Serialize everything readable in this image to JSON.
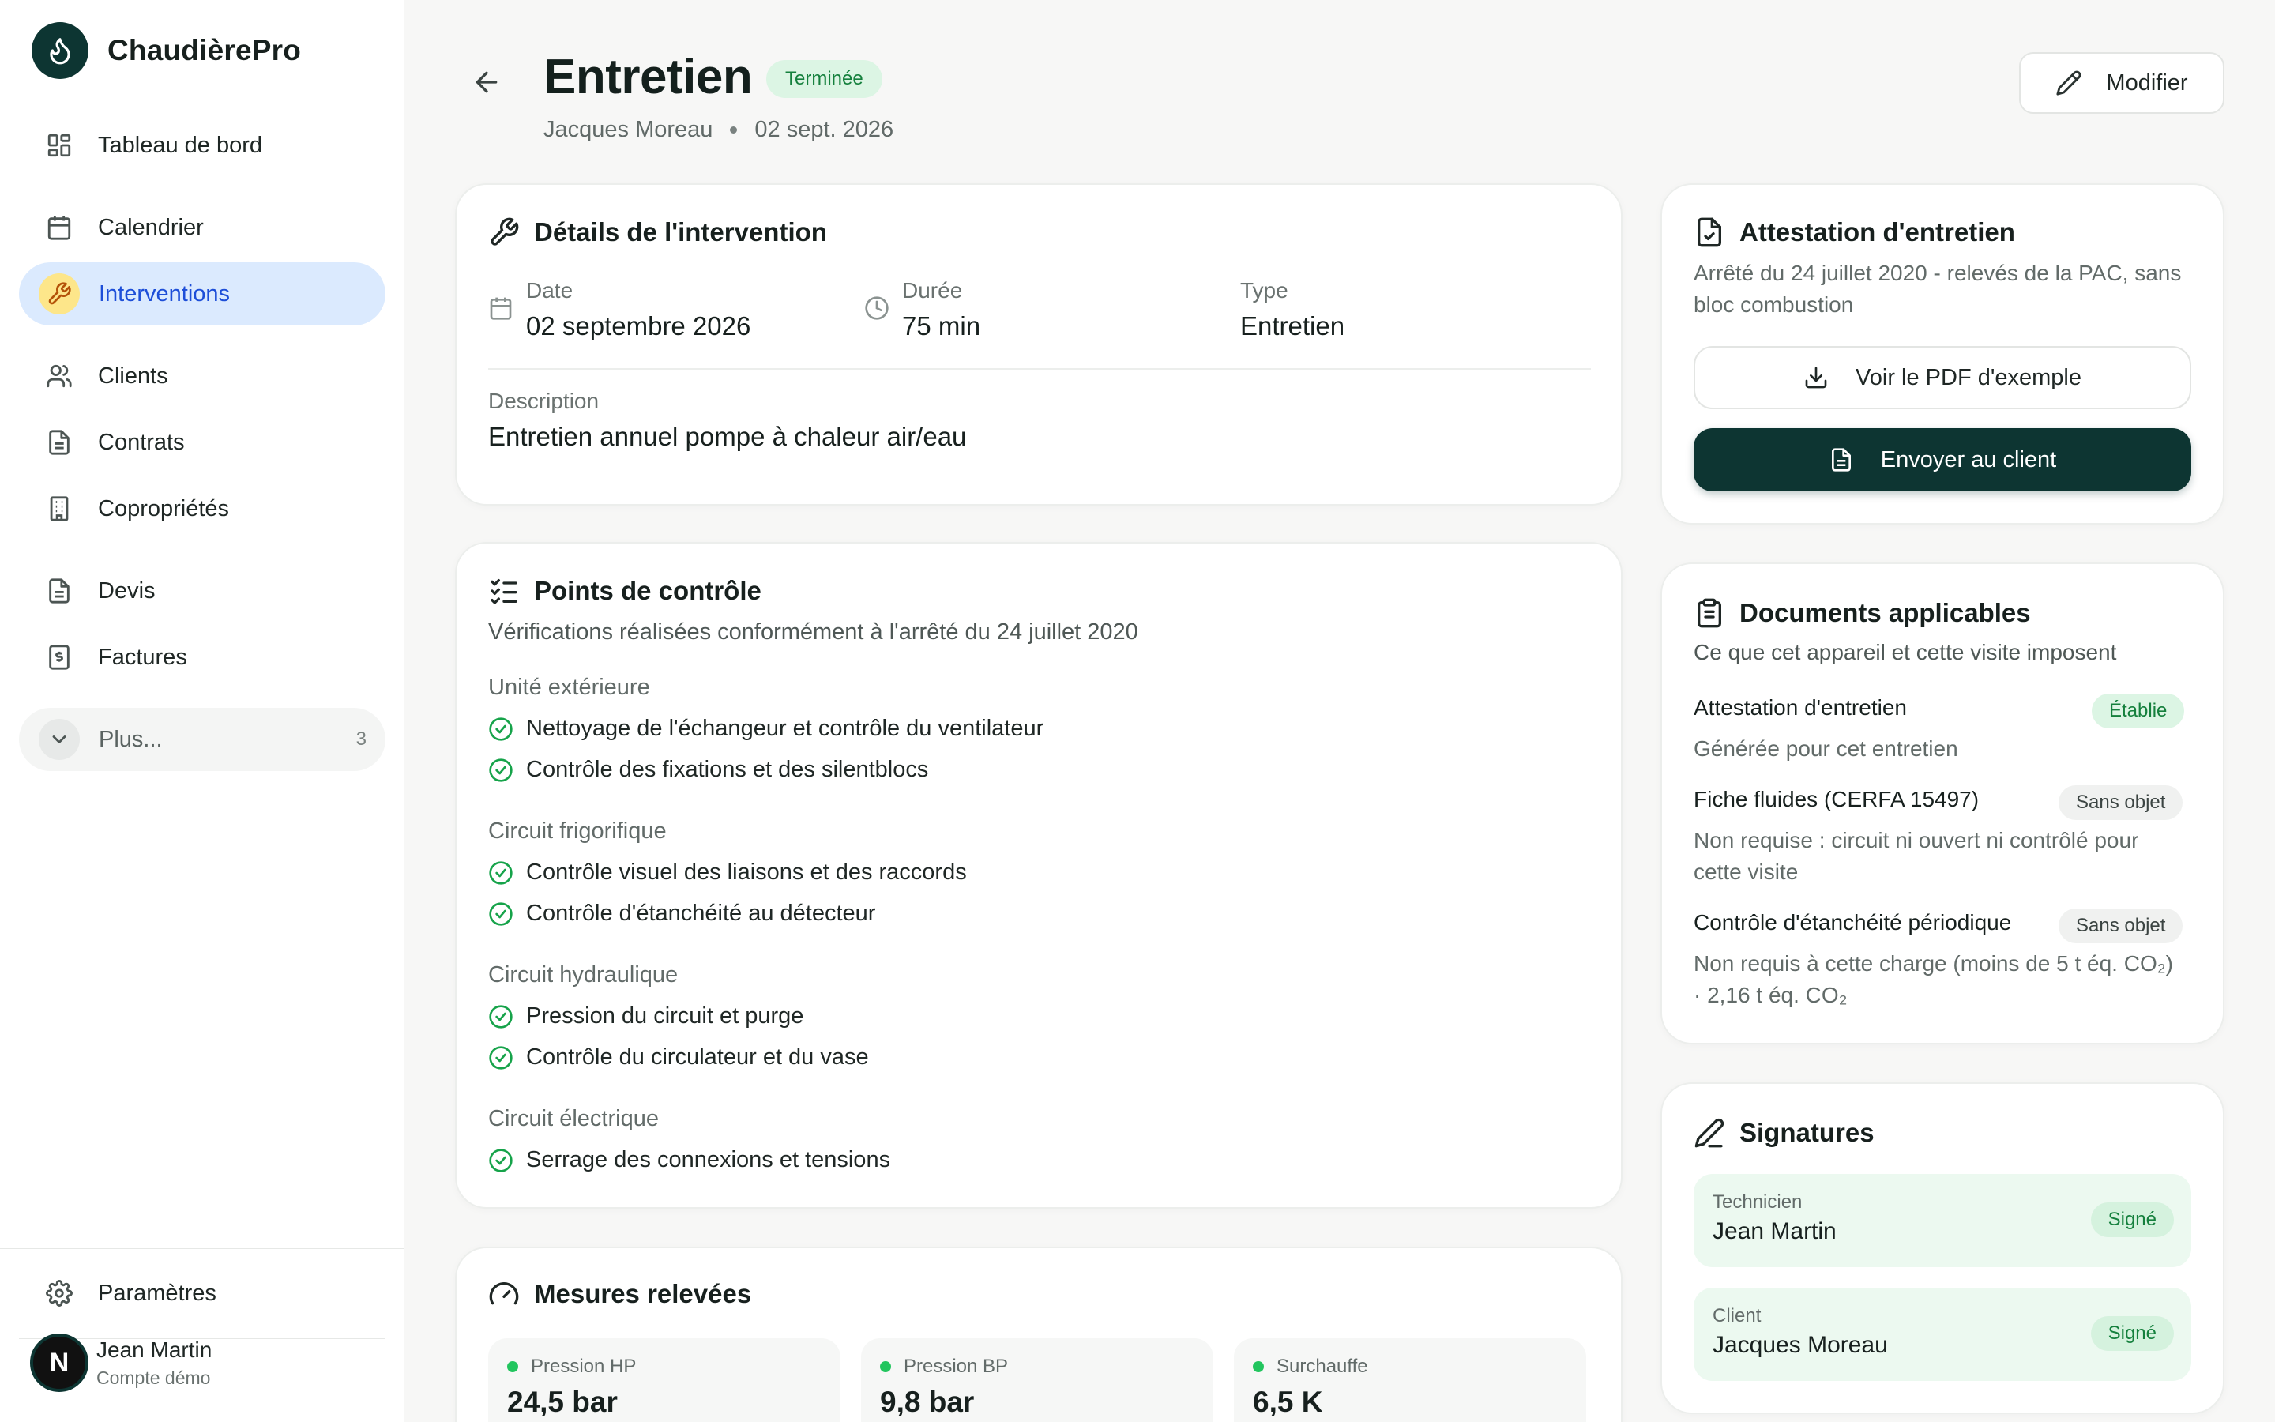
{
  "app": {
    "name": "ChaudièrePro"
  },
  "sidebar": {
    "items": [
      {
        "label": "Tableau de bord",
        "icon": "dashboard-icon"
      },
      {
        "label": "Calendrier",
        "icon": "calendar-icon"
      },
      {
        "label": "Interventions",
        "icon": "wrench-icon",
        "active": true
      },
      {
        "label": "Clients",
        "icon": "users-icon"
      },
      {
        "label": "Contrats",
        "icon": "file-icon"
      },
      {
        "label": "Copropriétés",
        "icon": "building-icon"
      },
      {
        "label": "Devis",
        "icon": "file-icon"
      },
      {
        "label": "Factures",
        "icon": "invoice-icon"
      }
    ],
    "more": {
      "label": "Plus...",
      "count": "3"
    },
    "settings": {
      "label": "Paramètres"
    },
    "user": {
      "initial": "N",
      "name": "Jean Martin",
      "subtitle": "Compte démo"
    }
  },
  "header": {
    "title": "Entretien",
    "status": "Terminée",
    "client": "Jacques Moreau",
    "date": "02 sept. 2026",
    "edit_label": "Modifier"
  },
  "details": {
    "title": "Détails de l'intervention",
    "date_label": "Date",
    "date_value": "02 septembre 2026",
    "duration_label": "Durée",
    "duration_value": "75 min",
    "type_label": "Type",
    "type_value": "Entretien",
    "description_label": "Description",
    "description_value": "Entretien annuel pompe à chaleur air/eau"
  },
  "checkpoints": {
    "title": "Points de contrôle",
    "subtitle": "Vérifications réalisées conformément à l'arrêté du 24 juillet 2020",
    "groups": [
      {
        "title": "Unité extérieure",
        "items": [
          "Nettoyage de l'échangeur et contrôle du ventilateur",
          "Contrôle des fixations et des silentblocs"
        ]
      },
      {
        "title": "Circuit frigorifique",
        "items": [
          "Contrôle visuel des liaisons et des raccords",
          "Contrôle d'étanchéité au détecteur"
        ]
      },
      {
        "title": "Circuit hydraulique",
        "items": [
          "Pression du circuit et purge",
          "Contrôle du circulateur et du vase"
        ]
      },
      {
        "title": "Circuit électrique",
        "items": [
          "Serrage des connexions et tensions"
        ]
      }
    ]
  },
  "measures": {
    "title": "Mesures relevées",
    "items": [
      {
        "label": "Pression HP",
        "value": "24,5 bar"
      },
      {
        "label": "Pression BP",
        "value": "9,8 bar"
      },
      {
        "label": "Surchauffe",
        "value": "6,5 K"
      }
    ]
  },
  "attestation": {
    "title": "Attestation d'entretien",
    "description": "Arrêté du 24 juillet 2020 - relevés de la PAC, sans bloc combustion",
    "view_pdf_label": "Voir le PDF d'exemple",
    "send_label": "Envoyer au client"
  },
  "documents": {
    "title": "Documents applicables",
    "subtitle": "Ce que cet appareil et cette visite imposent",
    "items": [
      {
        "title": "Attestation d'entretien",
        "badge": "Établie",
        "description": "Générée pour cet entretien"
      },
      {
        "title": "Fiche fluides (CERFA 15497)",
        "badge": "Sans objet",
        "description": "Non requise : circuit ni ouvert ni contrôlé pour cette visite"
      },
      {
        "title": "Contrôle d'étanchéité périodique",
        "badge": "Sans objet",
        "description": "Non requis à cette charge (moins de 5 t éq. CO₂) · 2,16 t éq. CO₂"
      }
    ]
  },
  "signatures": {
    "title": "Signatures",
    "items": [
      {
        "role": "Technicien",
        "name": "Jean Martin",
        "status": "Signé"
      },
      {
        "role": "Client",
        "name": "Jacques Moreau",
        "status": "Signé"
      }
    ]
  },
  "colors": {
    "brand": "#0d3532",
    "active_nav_bg": "#dbeafe",
    "active_nav_text": "#1d4ed8",
    "success": "#16a34a",
    "success_bg": "#dcf5e4"
  }
}
